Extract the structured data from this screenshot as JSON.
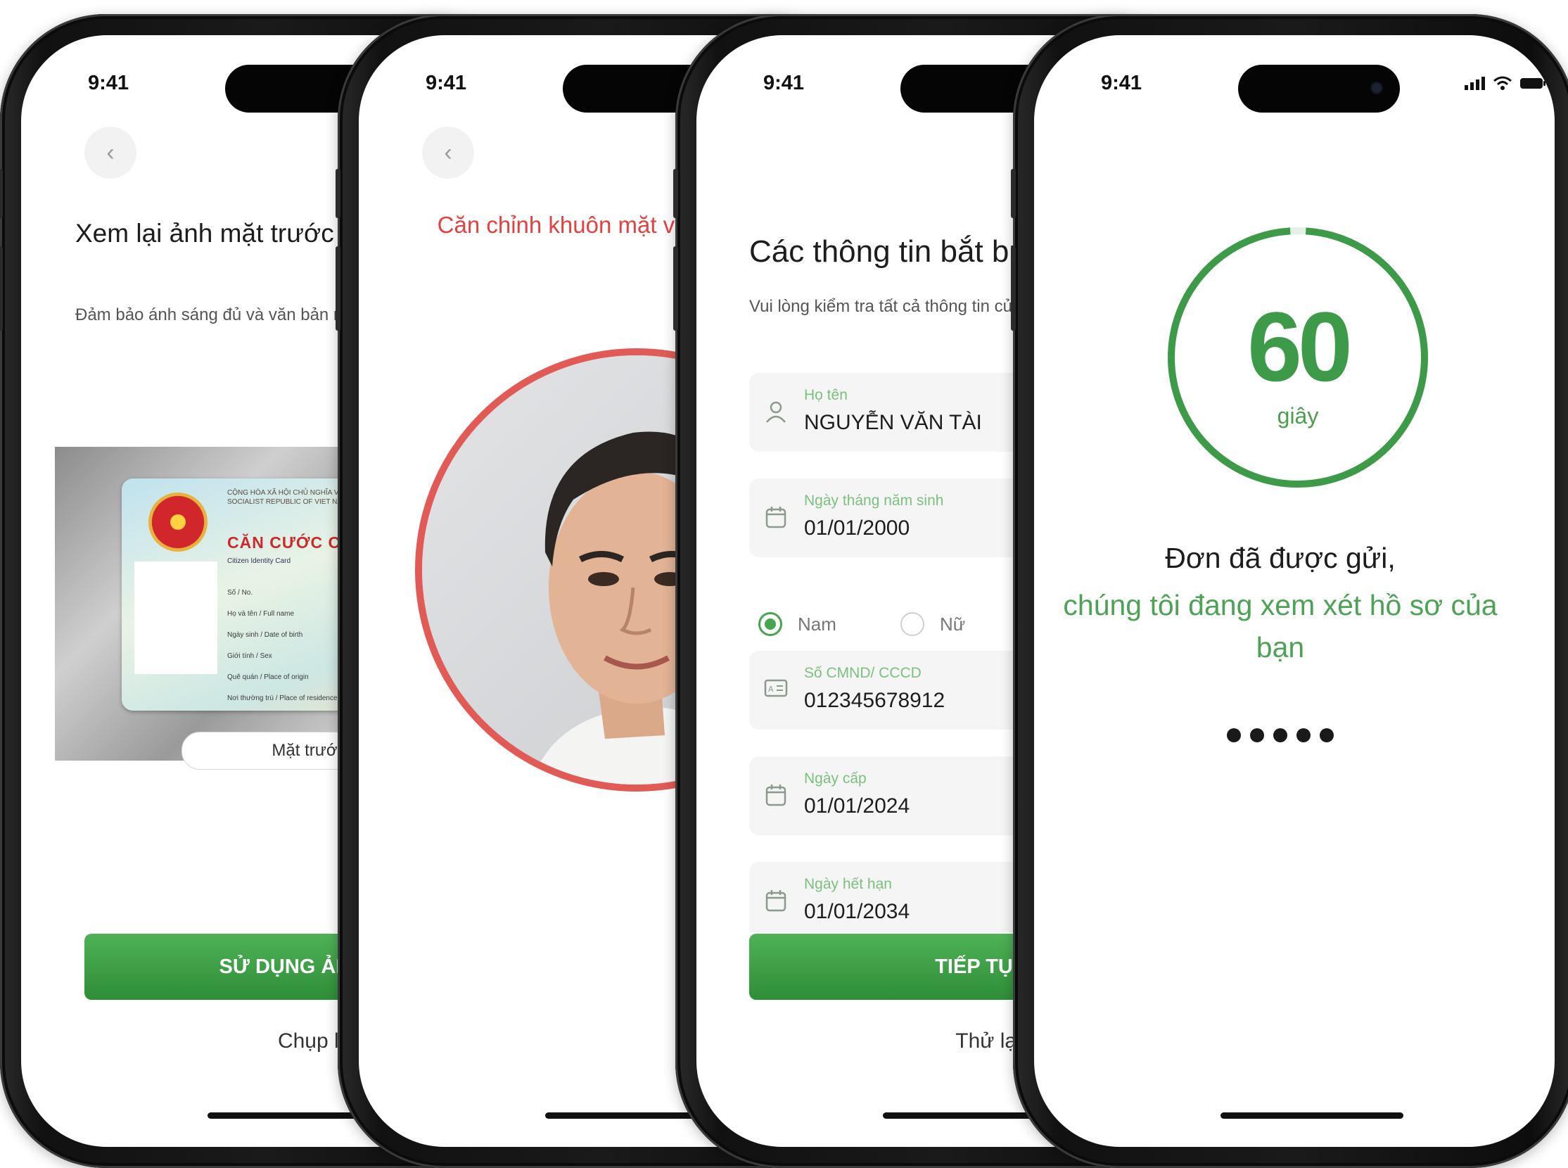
{
  "status": {
    "time": "9:41"
  },
  "screen1": {
    "title": "Xem lại ảnh mặt trước CMNN/CCCD",
    "subtitle": "Đảm bảo ánh sáng đủ và văn bản rõ ràng",
    "card": {
      "header": "CỘNG HÒA XÃ HỘI CHỦ NGHĨA VIỆT NAM · Độc lập - Tự do - Hạnh phúc · SOCIALIST REPUBLIC OF VIET NAM · Independence - Freedom - Happiness",
      "title": "CĂN CƯỚC CÔNG DÂN",
      "subtitle": "Citizen Identity Card",
      "lines": [
        "Số / No.",
        "Họ và tên / Full name",
        "Ngày sinh / Date of birth",
        "Giới tính / Sex",
        "Quê quán / Place of origin",
        "Nơi thường trú / Place of residence"
      ]
    },
    "side_label": "Mặt trước",
    "primary_button": "SỬ DỤNG ẢNH NÀY",
    "secondary_link": "Chụp lại"
  },
  "screen2": {
    "instruction": "Căn chỉnh khuôn mặt vào khung hình"
  },
  "screen3": {
    "title": "Các thông tin bắt buộc",
    "subtitle": "Vui lòng kiểm tra tất cả thông tin của bạn",
    "fields": [
      {
        "label": "Họ tên",
        "value": "NGUYỄN VĂN TÀI",
        "icon": "user-icon"
      },
      {
        "label": "Ngày tháng năm sinh",
        "value": "01/01/2000",
        "icon": "calendar-icon"
      },
      {
        "label": "Số CMND/ CCCD",
        "value": "012345678912",
        "icon": "id-card-icon"
      },
      {
        "label": "Ngày cấp",
        "value": "01/01/2024",
        "icon": "calendar-icon"
      },
      {
        "label": "Ngày hết hạn",
        "value": "01/01/2034",
        "icon": "calendar-icon"
      }
    ],
    "gender": {
      "male": "Nam",
      "female": "Nữ",
      "selected": "Nam"
    },
    "primary_button": "TIẾP TỤC",
    "secondary_link": "Thử lại"
  },
  "screen4": {
    "countdown": "60",
    "countdown_unit": "giây",
    "countdown_progress": 0.98,
    "message_line1": "Đơn đã được gửi,",
    "message_line2": "chúng tôi đang xem xét hồ sơ của bạn"
  },
  "colors": {
    "brand_green": "#3d9a48",
    "alert_red": "#e34240"
  }
}
